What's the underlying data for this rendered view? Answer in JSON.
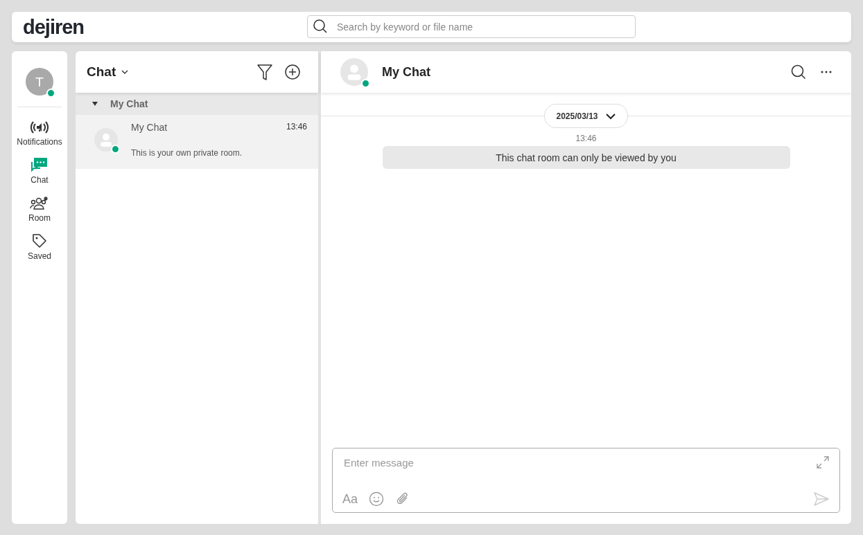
{
  "header": {
    "logo": "dejiren",
    "search": {
      "placeholder": "Search by keyword or file name"
    }
  },
  "user": {
    "initial": "T",
    "online": true
  },
  "nav": [
    {
      "kind": "notifications",
      "label": "Notifications",
      "selected": false
    },
    {
      "kind": "chat",
      "label": "Chat",
      "selected": true
    },
    {
      "kind": "room",
      "label": "Room",
      "selected": false
    },
    {
      "kind": "saved",
      "label": "Saved",
      "selected": false
    }
  ],
  "chat_list": {
    "title": "Chat",
    "groups": [
      {
        "name": "My Chat",
        "expanded": true,
        "items": [
          {
            "name": "My Chat",
            "time": "13:46",
            "preview": "This is your own private room.",
            "online": true,
            "selected": true
          }
        ]
      }
    ]
  },
  "conversation": {
    "title": "My Chat",
    "online": true,
    "date": "2025/03/13",
    "messages": [
      {
        "time": "13:46",
        "text": "This chat room can only be viewed by you"
      }
    ],
    "composer": {
      "placeholder": "Enter message",
      "format_label": "Aa"
    }
  }
}
